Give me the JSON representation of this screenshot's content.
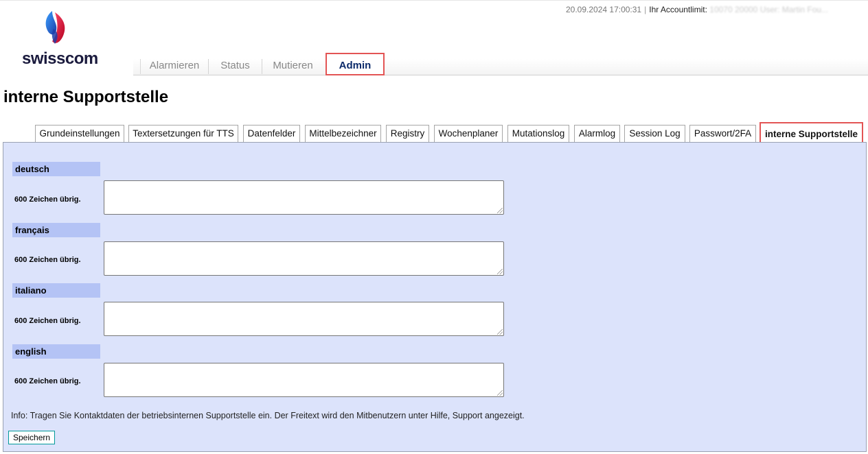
{
  "header": {
    "datetime": "20.09.2024 17:00:31",
    "account_limit_label": "Ihr Accountlimit:",
    "account_limit_value": "10070 20000",
    "user_label": "User:",
    "user_value": "Martin Fou..."
  },
  "logo": {
    "text": "swisscom"
  },
  "main_nav": {
    "items": [
      {
        "label": "Alarmieren"
      },
      {
        "label": "Status"
      },
      {
        "label": "Mutieren"
      },
      {
        "label": "Admin"
      }
    ],
    "active": "Admin"
  },
  "page_title": "interne Supportstelle",
  "tabs": [
    {
      "label": "Grundeinstellungen"
    },
    {
      "label": "Textersetzungen für TTS"
    },
    {
      "label": "Datenfelder"
    },
    {
      "label": "Mittelbezeichner"
    },
    {
      "label": "Registry"
    },
    {
      "label": "Wochenplaner"
    },
    {
      "label": "Mutationslog"
    },
    {
      "label": "Alarmlog"
    },
    {
      "label": "Session Log"
    },
    {
      "label": "Passwort/2FA"
    },
    {
      "label": "interne Supportstelle"
    }
  ],
  "active_tab": "interne Supportstelle",
  "languages": [
    {
      "label": "deutsch",
      "remaining": "600 Zeichen übrig.",
      "value": ""
    },
    {
      "label": "français",
      "remaining": "600 Zeichen übrig.",
      "value": ""
    },
    {
      "label": "italiano",
      "remaining": "600 Zeichen übrig.",
      "value": ""
    },
    {
      "label": "english",
      "remaining": "600 Zeichen übrig.",
      "value": ""
    }
  ],
  "info_text": "Info: Tragen Sie Kontaktdaten der betriebsinternen Supportstelle ein. Der Freitext wird den Mitbenutzern unter Hilfe, Support angezeigt.",
  "save_label": "Speichern",
  "colors": {
    "panel_bg": "#dce3fb",
    "lang_header_bg": "#b4c3f5",
    "highlight": "#e35454",
    "active_nav_text": "#0b2a6a"
  }
}
